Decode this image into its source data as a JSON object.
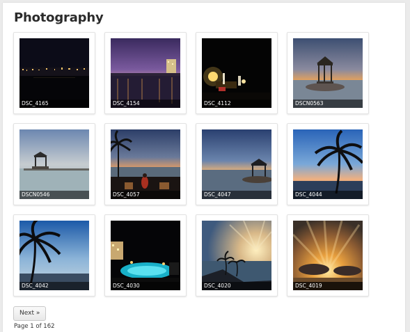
{
  "page": {
    "title": "Photography"
  },
  "gallery": {
    "items": [
      {
        "caption": "DSC_4165",
        "scene": "harbor-night"
      },
      {
        "caption": "DSC_4154",
        "scene": "purple-dusk-hotel"
      },
      {
        "caption": "DSC_4112",
        "scene": "candlelit-dinner"
      },
      {
        "caption": "DSCN0563",
        "scene": "gazebo-dusk"
      },
      {
        "caption": "DSCN0546",
        "scene": "gazebo-day"
      },
      {
        "caption": "DSC_4057",
        "scene": "palm-sunset-woman"
      },
      {
        "caption": "DSC_4047",
        "scene": "gazebo-twilight"
      },
      {
        "caption": "DSC_4044",
        "scene": "palm-blue-sky"
      },
      {
        "caption": "DSC_4042",
        "scene": "palm-silhouette"
      },
      {
        "caption": "DSC_4030",
        "scene": "pool-night"
      },
      {
        "caption": "DSC_4020",
        "scene": "sun-rays-beach"
      },
      {
        "caption": "DSC_4019",
        "scene": "golden-rays"
      }
    ]
  },
  "pagination": {
    "next_label": "Next »",
    "page_info": "Page 1 of 162"
  },
  "colors": {
    "background": "#ebebeb",
    "card": "#ffffff",
    "caption_bg": "rgba(0,0,0,0.55)"
  }
}
